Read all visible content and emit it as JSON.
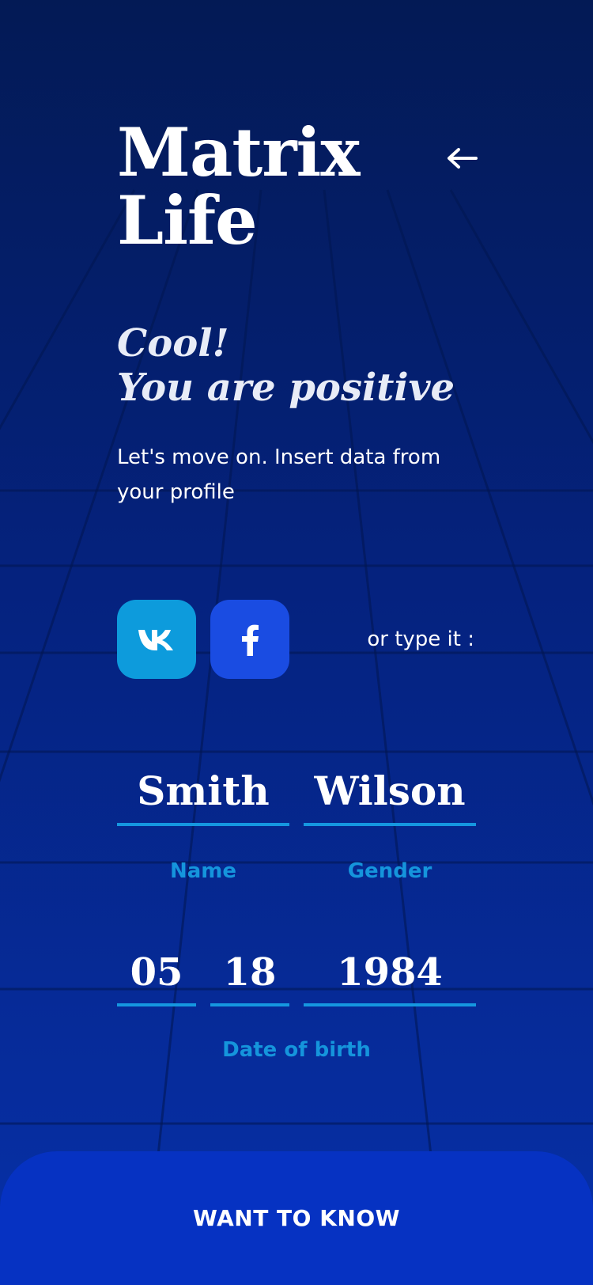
{
  "app": {
    "title_line1": "Matrix",
    "title_line2": "Life"
  },
  "header": {
    "back_icon": "arrow-left-icon"
  },
  "message": {
    "line1": "Cool!",
    "line2": "You are positive",
    "instruction": "Let's move on. Insert data from your profile"
  },
  "social": {
    "vk_icon": "vk-logo-icon",
    "facebook_icon": "facebook-logo-icon",
    "or_type_label": "or type it :",
    "vk_color": "#0d9bdc",
    "facebook_color": "#1a4ce2"
  },
  "form": {
    "name_value": "Smith",
    "gender_value": "Wilson",
    "name_label": "Name",
    "gender_label": "Gender",
    "dob_month": "05",
    "dob_day": "18",
    "dob_year": "1984",
    "dob_label": "Date of birth",
    "accent_color": "#1597e0"
  },
  "cta": {
    "label": "WANT TO KNOW"
  }
}
